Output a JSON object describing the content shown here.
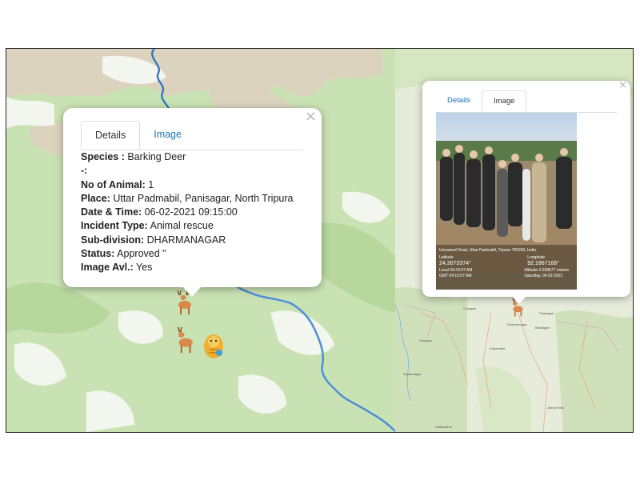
{
  "left_popup": {
    "tabs": [
      {
        "label": "Details",
        "active": true
      },
      {
        "label": "Image",
        "active": false
      }
    ],
    "close": "×",
    "fields": [
      {
        "label": "Species :",
        "value": "Barking Deer"
      },
      {
        "label": "-:",
        "value": ""
      },
      {
        "label": "No of Animal:",
        "value": "1"
      },
      {
        "label": "Place:",
        "value": "Uttar Padmabil, Panisagar, North Tripura"
      },
      {
        "label": "Date & Time:",
        "value": "06-02-2021 09:15:00"
      },
      {
        "label": "Incident Type:",
        "value": "Animal rescue"
      },
      {
        "label": "Sub-division:",
        "value": "DHARMANAGAR"
      },
      {
        "label": "Status:",
        "value": "Approved ''"
      },
      {
        "label": "Image Avl.:",
        "value": "Yes"
      }
    ]
  },
  "right_popup": {
    "tabs": [
      {
        "label": "Details",
        "active": false
      },
      {
        "label": "Image",
        "active": true
      }
    ],
    "close": "×",
    "photo": {
      "address": "Unnamed Road, Uttar Padmabil, Tripura 799260, India",
      "latitude_label": "Latitude",
      "latitude": "24.3073374°",
      "longitude_label": "Longitude",
      "longitude": "92.1867168°",
      "local_time": "Local 09:43:07 AM",
      "gmt_time": "GMT 04:13:07 AM",
      "altitude": "Altitude 0.038677 meters",
      "date": "Saturday, 06-02-2021"
    }
  },
  "map_labels": [
    "Chargole",
    "Dharmanagar",
    "Panisagar",
    "Durgapur",
    "Kadamtala",
    "Bishalgarh",
    "Jamuri Hills",
    "Shyamnagar",
    "Kailashahar"
  ],
  "markers": [
    "deer-marker",
    "deer-marker",
    "tiger-marker",
    "deer-marker"
  ]
}
